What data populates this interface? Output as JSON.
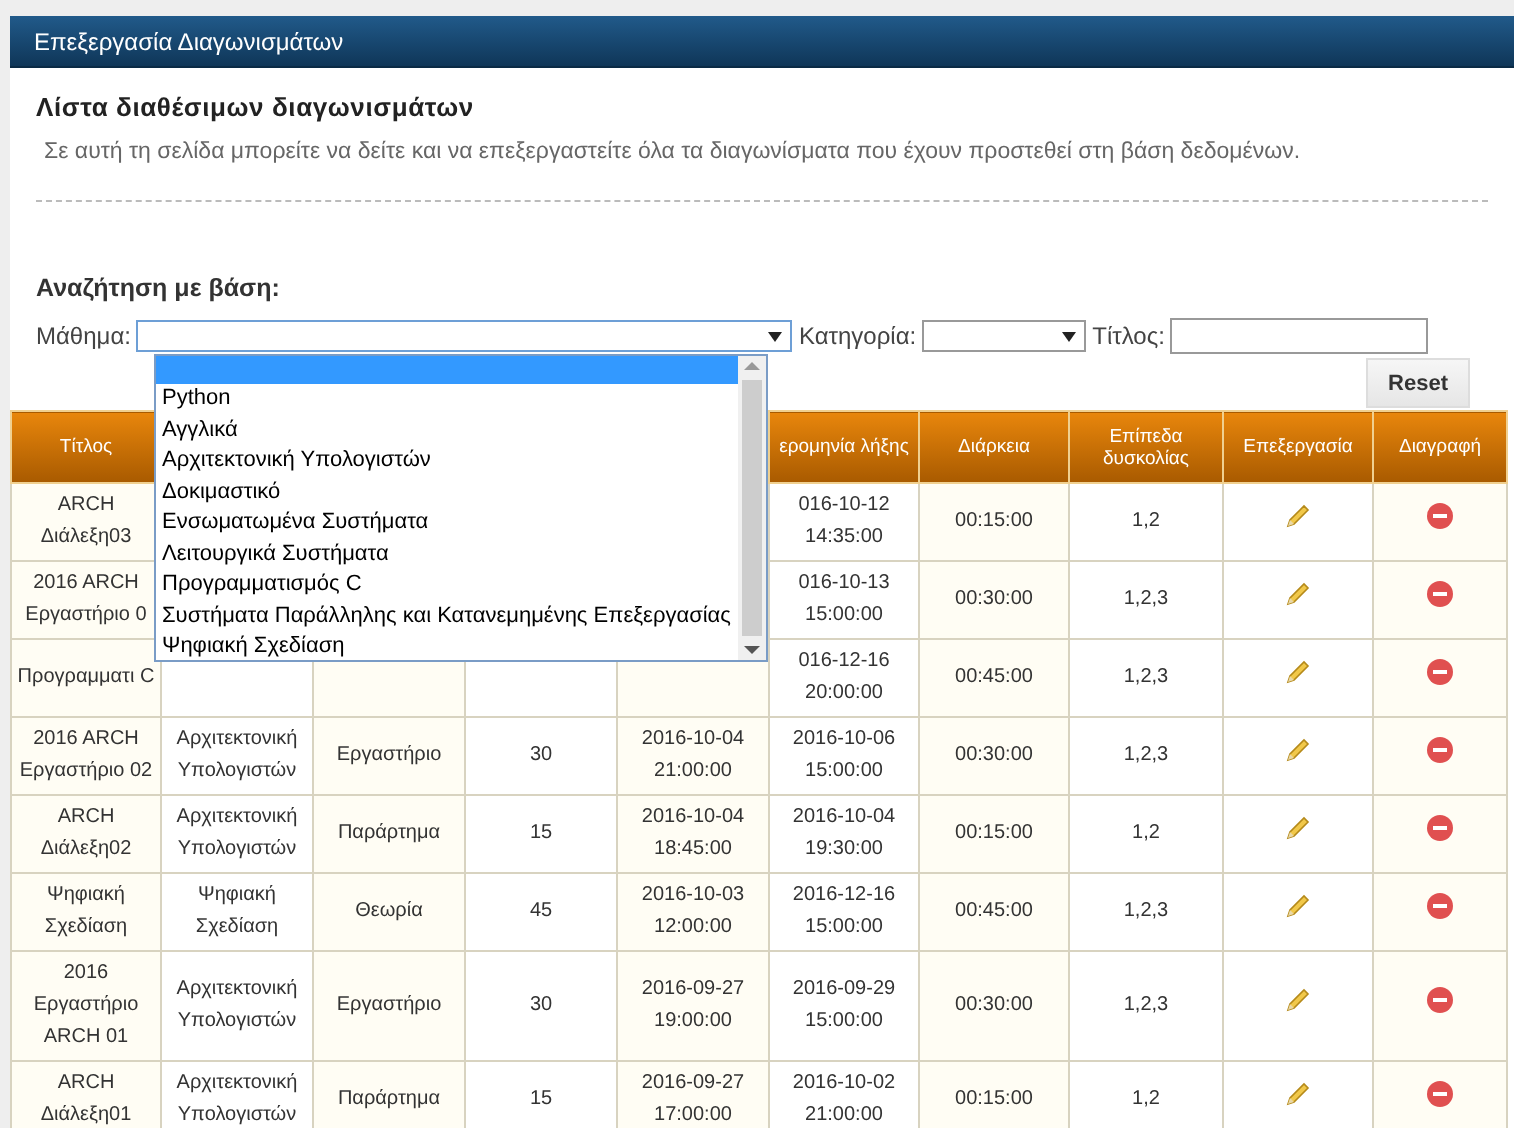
{
  "window": {
    "title": "Επεξεργασία Διαγωνισμάτων"
  },
  "heading": "Λίστα διαθέσιμων διαγωνισμάτων",
  "description": "Σε αυτή τη σελίδα μπορείτε να δείτε και να επεξεργαστείτε όλα τα διαγωνίσματα που έχουν προστεθεί στη βάση δεδομένων.",
  "search": {
    "title": "Αναζήτηση με βάση:",
    "course": {
      "label": "Μάθημα:",
      "open": true,
      "blank_option_highlighted": true,
      "options": [
        {
          "label": "Python",
          "selected": false
        },
        {
          "label": "Αγγλικά",
          "selected": false
        },
        {
          "label": "Αρχιτεκτονική Υπολογιστών",
          "selected": false
        },
        {
          "label": "Δοκιμαστικό",
          "selected": false
        },
        {
          "label": "Ενσωματωμένα Συστήματα",
          "selected": false
        },
        {
          "label": "Λειτουργικά Συστήματα",
          "selected": false
        },
        {
          "label": "Προγραμματισμός C",
          "selected": false
        },
        {
          "label": "Συστήματα Παράλληλης και Κατανεμημένης Επεξεργασίας",
          "selected": false
        },
        {
          "label": "Ψηφιακή Σχεδίαση",
          "selected": false
        }
      ]
    },
    "category": {
      "label": "Κατηγορία:"
    },
    "title_field": {
      "label": "Τίτλος:"
    },
    "reset": "Reset"
  },
  "table": {
    "columns": [
      "Τίτλος",
      null,
      null,
      null,
      null,
      "ερομηνία λήξης",
      "Διάρκεια",
      "Επίπεδα δυσκολίας",
      "Επεξεργασία",
      "Διαγραφή"
    ],
    "rows": [
      {
        "cells": [
          "ARCH Διάλεξη03",
          null,
          null,
          null,
          null,
          "016-10-12 14:35:00",
          "00:15:00",
          "1,2"
        ]
      },
      {
        "cells": [
          "2016 ARCH Εργαστήριο 0",
          null,
          null,
          null,
          null,
          "016-10-13 15:00:00",
          "00:30:00",
          "1,2,3"
        ]
      },
      {
        "cells": [
          "Προγραμματι C",
          null,
          null,
          null,
          null,
          "016-12-16 20:00:00",
          "00:45:00",
          "1,2,3"
        ]
      },
      {
        "cells": [
          "2016 ARCH Εργαστήριο 02",
          "Αρχιτεκτονική Υπολογιστών",
          "Εργαστήριο",
          "30",
          "2016-10-04 21:00:00",
          "2016-10-06 15:00:00",
          "00:30:00",
          "1,2,3"
        ]
      },
      {
        "cells": [
          "ARCH Διάλεξη02",
          "Αρχιτεκτονική Υπολογιστών",
          "Παράρτημα",
          "15",
          "2016-10-04 18:45:00",
          "2016-10-04 19:30:00",
          "00:15:00",
          "1,2"
        ]
      },
      {
        "cells": [
          "Ψηφιακή Σχεδίαση",
          "Ψηφιακή Σχεδίαση",
          "Θεωρία",
          "45",
          "2016-10-03 12:00:00",
          "2016-12-16 15:00:00",
          "00:45:00",
          "1,2,3"
        ]
      },
      {
        "cells": [
          "2016 Εργαστήριο ARCH 01",
          "Αρχιτεκτονική Υπολογιστών",
          "Εργαστήριο",
          "30",
          "2016-09-27 19:00:00",
          "2016-09-29 15:00:00",
          "00:30:00",
          "1,2,3"
        ]
      },
      {
        "cells": [
          "ARCH Διάλεξη01",
          "Αρχιτεκτονική Υπολογιστών",
          "Παράρτημα",
          "15",
          "2016-09-27 17:00:00",
          "2016-10-02 21:00:00",
          "00:15:00",
          "1,2"
        ]
      }
    ]
  }
}
